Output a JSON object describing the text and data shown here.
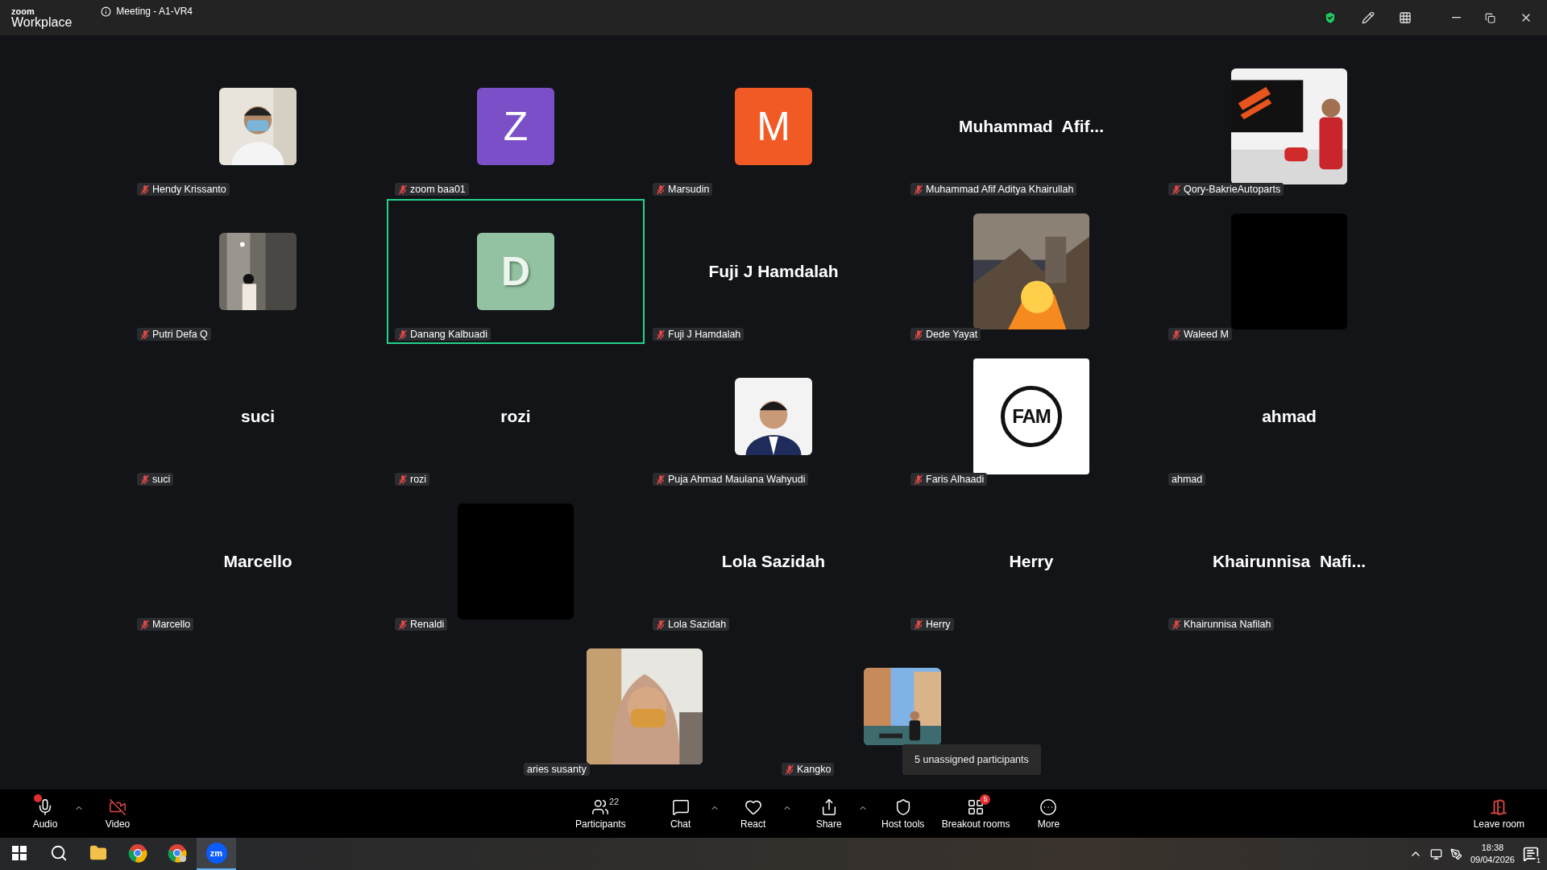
{
  "title_bar": {
    "logo_top": "zoom",
    "logo_bottom": "Workplace",
    "meeting_title": "Meeting - A1-VR4"
  },
  "tiles": [
    {
      "name": "Hendy Krissanto",
      "muted": true,
      "active": false
    },
    {
      "name": "zoom baa01",
      "kind": "letter",
      "letter": "Z",
      "color": "#7a4fc8",
      "muted": true,
      "active": false
    },
    {
      "name": "Marsudin",
      "kind": "letter",
      "letter": "M",
      "color": "#f15a24",
      "muted": true,
      "active": false
    },
    {
      "name": "Muhammad Afif Aditya Khairullah",
      "kind": "name",
      "display_name": "Muhammad  Afif...",
      "muted": true,
      "active": false
    },
    {
      "name": "Qory-BakrieAutoparts",
      "kind": "photo_large",
      "muted": true,
      "active": false
    },
    {
      "name": "Putri Defa Q",
      "muted": true,
      "active": false
    },
    {
      "name": "Danang Kalbuadi",
      "kind": "letter",
      "letter": "D",
      "color": "#93c2a2",
      "muted": true,
      "active": true
    },
    {
      "name": "Fuji J Hamdalah",
      "kind": "name",
      "display_name": "Fuji J Hamdalah",
      "muted": true,
      "active": false
    },
    {
      "name": "Dede Yayat",
      "kind": "photo_large",
      "muted": true,
      "active": false
    },
    {
      "name": "Waleed M",
      "kind": "blank",
      "muted": true,
      "active": false
    },
    {
      "name": "suci",
      "kind": "name",
      "display_name": "suci",
      "muted": true,
      "active": false
    },
    {
      "name": "rozi",
      "kind": "name",
      "display_name": "rozi",
      "muted": true,
      "active": false
    },
    {
      "name": "Puja Ahmad Maulana Wahyudi",
      "muted": true,
      "active": false
    },
    {
      "name": "Faris Alhaadi",
      "kind": "logo",
      "logo_text": "FAM",
      "muted": true,
      "active": false
    },
    {
      "name": "ahmad",
      "kind": "name",
      "display_name": "ahmad",
      "muted": false,
      "active": false
    },
    {
      "name": "Marcello",
      "kind": "name",
      "display_name": "Marcello",
      "muted": true,
      "active": false
    },
    {
      "name": "Renaldi",
      "kind": "blank",
      "muted": true,
      "active": false
    },
    {
      "name": "Lola Sazidah",
      "kind": "name",
      "display_name": "Lola Sazidah",
      "muted": true,
      "active": false
    },
    {
      "name": "Herry",
      "kind": "name",
      "display_name": "Herry",
      "muted": true,
      "active": false
    },
    {
      "name": "Khairunnisa Nafilah",
      "kind": "name",
      "display_name": "Khairunnisa  Nafi...",
      "muted": true,
      "active": false
    },
    {
      "name": "aries susanty",
      "kind": "photo_large",
      "muted": false,
      "active": false
    },
    {
      "name": "Kangko",
      "muted": true,
      "active": false
    }
  ],
  "tooltip": "5 unassigned participants",
  "toolbar": [
    {
      "kind": "audio",
      "label": "Audio",
      "caret": true
    },
    {
      "kind": "video",
      "label": "Video",
      "caret": false
    },
    {
      "kind": "participants",
      "label": "Participants",
      "count": "22",
      "caret": false
    },
    {
      "kind": "chat",
      "label": "Chat",
      "caret": true
    },
    {
      "kind": "react",
      "label": "React",
      "caret": true
    },
    {
      "kind": "share",
      "label": "Share",
      "caret": true
    },
    {
      "kind": "host",
      "label": "Host tools",
      "caret": false
    },
    {
      "kind": "breakout",
      "label": "Breakout rooms",
      "badge": "5",
      "caret": false
    },
    {
      "kind": "more",
      "label": "More",
      "caret": false
    }
  ],
  "leave": {
    "label": "Leave room"
  },
  "taskbar": {
    "apps": [
      {
        "kind": "search",
        "selected": false
      },
      {
        "kind": "explorer",
        "selected": false
      },
      {
        "kind": "chrome",
        "selected": false
      },
      {
        "kind": "chrome_profile",
        "selected": false
      },
      {
        "kind": "zoom",
        "label": "zm",
        "selected": true
      }
    ],
    "time": "18:38",
    "date": "09/04/2026",
    "notifications": "1"
  }
}
